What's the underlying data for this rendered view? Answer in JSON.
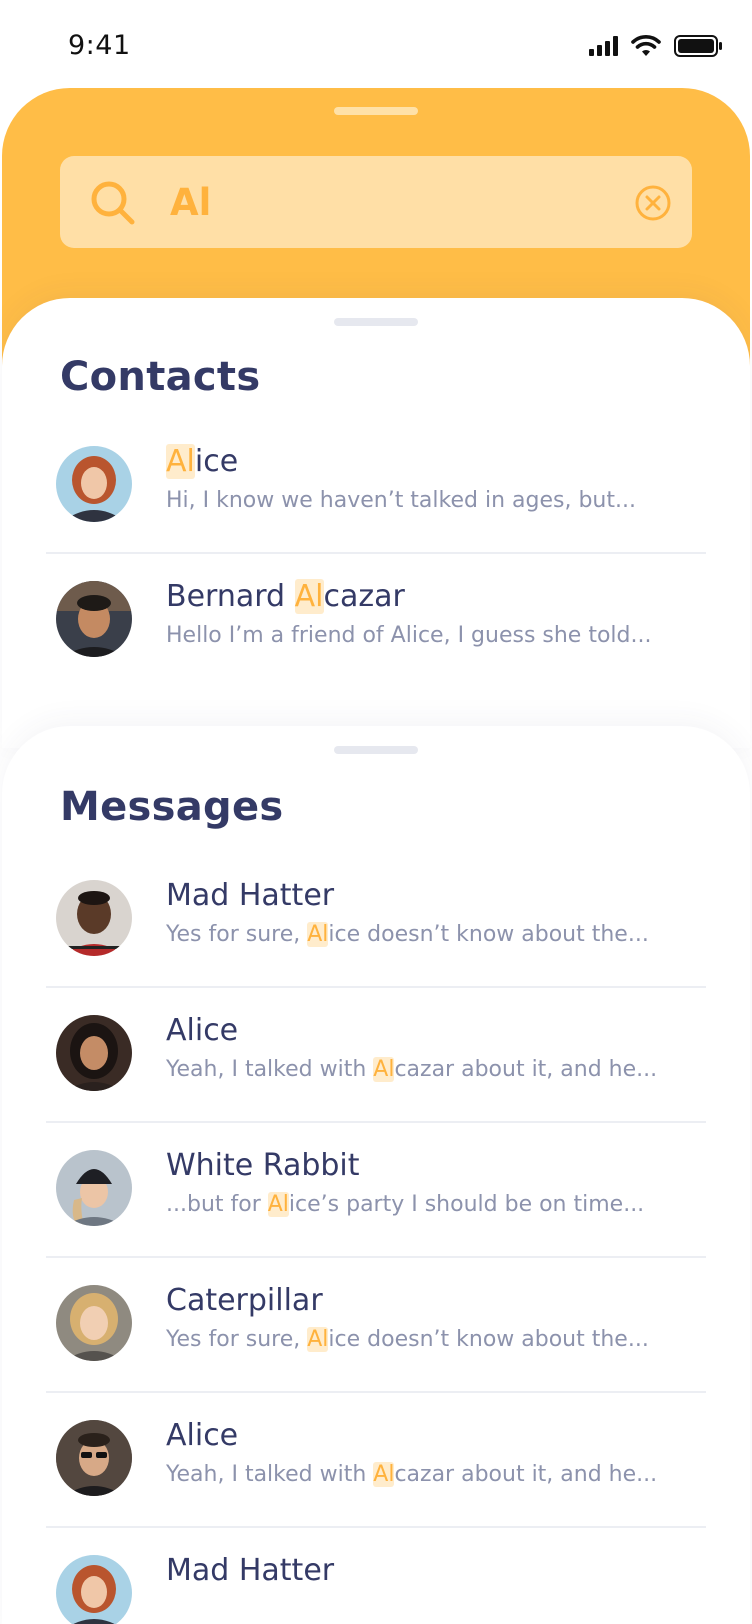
{
  "status_bar": {
    "time": "9:41"
  },
  "search": {
    "query": "Al"
  },
  "contacts": {
    "title": "Contacts",
    "items": [
      {
        "name_pre": "",
        "name_hl": "Al",
        "name_post": "ice",
        "snippet_pre": "Hi, I know we haven’t talked in ages, but...",
        "snippet_hl": "",
        "snippet_post": ""
      },
      {
        "name_pre": "Bernard ",
        "name_hl": "Al",
        "name_post": "cazar",
        "snippet_pre": "Hello I’m a friend of Alice, I guess she told...",
        "snippet_hl": "",
        "snippet_post": ""
      }
    ]
  },
  "messages": {
    "title": "Messages",
    "items": [
      {
        "name_pre": "Mad Hatter",
        "name_hl": "",
        "name_post": "",
        "snippet_pre": "Yes for sure, ",
        "snippet_hl": "Al",
        "snippet_post": "ice doesn’t know about the..."
      },
      {
        "name_pre": "Alice",
        "name_hl": "",
        "name_post": "",
        "snippet_pre": "Yeah, I talked with ",
        "snippet_hl": "Al",
        "snippet_post": "cazar about it, and he..."
      },
      {
        "name_pre": "White Rabbit",
        "name_hl": "",
        "name_post": "",
        "snippet_pre": "...but for ",
        "snippet_hl": "Al",
        "snippet_post": "ice’s party I should be on time..."
      },
      {
        "name_pre": "Caterpillar",
        "name_hl": "",
        "name_post": "",
        "snippet_pre": "Yes for sure, ",
        "snippet_hl": "Al",
        "snippet_post": "ice doesn’t know about the..."
      },
      {
        "name_pre": "Alice",
        "name_hl": "",
        "name_post": "",
        "snippet_pre": "Yeah, I talked with ",
        "snippet_hl": "Al",
        "snippet_post": "cazar about it, and he..."
      },
      {
        "name_pre": "Mad Hatter",
        "name_hl": "",
        "name_post": "",
        "snippet_pre": "",
        "snippet_hl": "",
        "snippet_post": ""
      }
    ]
  },
  "colors": {
    "accent": "#ffbd47",
    "highlight_text": "#ffb23d",
    "highlight_bg": "#ffeccc",
    "title": "#343a66",
    "snippet": "#8c92ac"
  }
}
